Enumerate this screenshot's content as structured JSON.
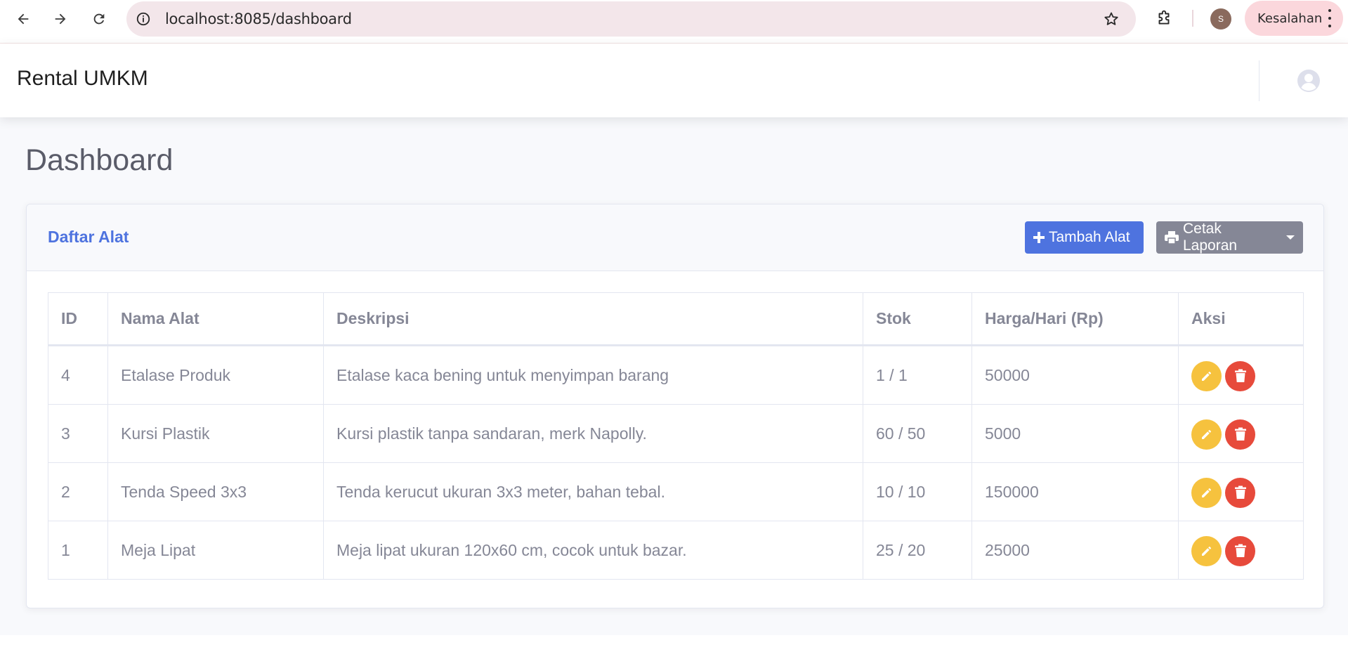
{
  "browser": {
    "url": "localhost:8085/dashboard",
    "profile_initial": "S",
    "profile_label": "Kesalahan"
  },
  "topbar": {
    "brand": "Rental UMKM"
  },
  "page": {
    "title": "Dashboard"
  },
  "card": {
    "title": "Daftar Alat",
    "add_button": "Tambah Alat",
    "print_button": "Cetak Laporan"
  },
  "table": {
    "headers": [
      "ID",
      "Nama Alat",
      "Deskripsi",
      "Stok",
      "Harga/Hari (Rp)",
      "Aksi"
    ],
    "rows": [
      {
        "id": "4",
        "nama": "Etalase Produk",
        "deskripsi": "Etalase kaca bening untuk menyimpan barang",
        "stok": "1 / 1",
        "harga": "50000"
      },
      {
        "id": "3",
        "nama": "Kursi Plastik",
        "deskripsi": "Kursi plastik tanpa sandaran, merk Napolly.",
        "stok": "60 / 50",
        "harga": "5000"
      },
      {
        "id": "2",
        "nama": "Tenda Speed 3x3",
        "deskripsi": "Tenda kerucut ukuran 3x3 meter, bahan tebal.",
        "stok": "10 / 10",
        "harga": "150000"
      },
      {
        "id": "1",
        "nama": "Meja Lipat",
        "deskripsi": "Meja lipat ukuran 120x60 cm, cocok untuk bazar.",
        "stok": "25 / 20",
        "harga": "25000"
      }
    ]
  },
  "icons": {
    "back": "arrow-left-icon",
    "forward": "arrow-right-icon",
    "reload": "reload-icon",
    "site_info": "info-icon",
    "bookmark": "star-icon",
    "extensions": "puzzle-icon",
    "menu": "kebab-menu-icon",
    "user": "user-circle-icon",
    "add": "plus-icon",
    "print": "printer-icon",
    "edit": "pencil-icon",
    "delete": "trash-icon"
  },
  "colors": {
    "primary": "#4e73df",
    "secondary": "#858796",
    "warning": "#f6c23e",
    "danger": "#e74a3b",
    "text_muted": "#858796",
    "heading": "#5a5c69"
  }
}
